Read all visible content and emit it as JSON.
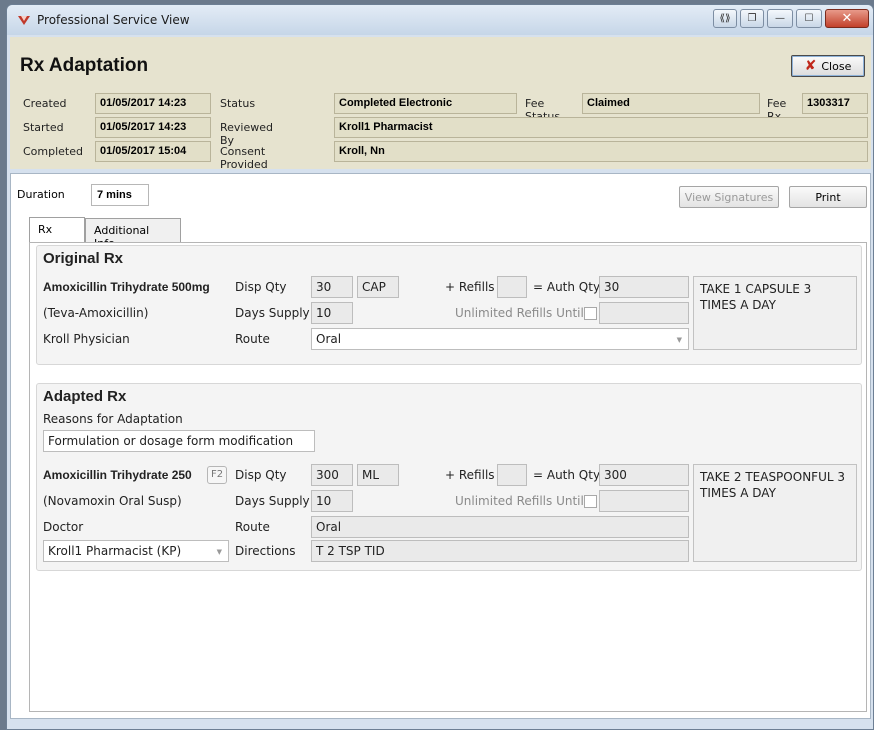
{
  "window": {
    "title": "Professional Service View"
  },
  "header": {
    "page_title": "Rx Adaptation",
    "close_label": "Close",
    "created_label": "Created",
    "created_value": "01/05/2017 14:23",
    "started_label": "Started",
    "started_value": "01/05/2017 14:23",
    "completed_label": "Completed",
    "completed_value": "01/05/2017 15:04",
    "status_label": "Status",
    "status_value": "Completed Electronic",
    "reviewed_label": "Reviewed By",
    "reviewed_value": "Kroll1 Pharmacist",
    "consent_label": "Consent Provided by",
    "consent_value": "Kroll, Nn",
    "fee_status_label": "Fee Status",
    "fee_status_value": "Claimed",
    "fee_rx_label": "Fee Rx",
    "fee_rx_value": "1303317"
  },
  "main": {
    "duration_label": "Duration",
    "duration_value": "7 mins",
    "view_signatures_label": "View Signatures",
    "print_label": "Print",
    "tabs": [
      {
        "label": "Rx"
      },
      {
        "label": "Additional Info"
      }
    ]
  },
  "original": {
    "title": "Original Rx",
    "drug": "Amoxicillin Trihydrate 500mg",
    "brand": "(Teva-Amoxicillin)",
    "prescriber": "Kroll Physician",
    "disp_qty_label": "Disp Qty",
    "disp_qty": "30",
    "unit": "CAP",
    "refills_label": "+ Refills",
    "refills": "",
    "auth_qty_label": "= Auth Qty",
    "auth_qty": "30",
    "days_supply_label": "Days Supply",
    "days_supply": "10",
    "unlimited_label": "Unlimited Refills Until",
    "unlimited_date": "",
    "route_label": "Route",
    "route": "Oral",
    "sig": "TAKE 1 CAPSULE 3 TIMES A DAY"
  },
  "adapted": {
    "title": "Adapted Rx",
    "reasons_label": "Reasons for Adaptation",
    "reason": "Formulation or dosage form modification",
    "drug": "Amoxicillin Trihydrate 250",
    "f2_label": "F2",
    "brand": "(Novamoxin Oral Susp)",
    "doctor_label": "Doctor",
    "doctor": "Kroll1 Pharmacist (KP)",
    "disp_qty_label": "Disp Qty",
    "disp_qty": "300",
    "unit": "ML",
    "refills_label": "+ Refills",
    "refills": "",
    "auth_qty_label": "= Auth Qty",
    "auth_qty": "300",
    "days_supply_label": "Days Supply",
    "days_supply": "10",
    "unlimited_label": "Unlimited Refills Until",
    "unlimited_date": "",
    "route_label": "Route",
    "route": "Oral",
    "directions_label": "Directions",
    "directions": "T 2 TSP TID",
    "sig": "TAKE 2 TEASPOONFUL 3 TIMES A DAY"
  }
}
